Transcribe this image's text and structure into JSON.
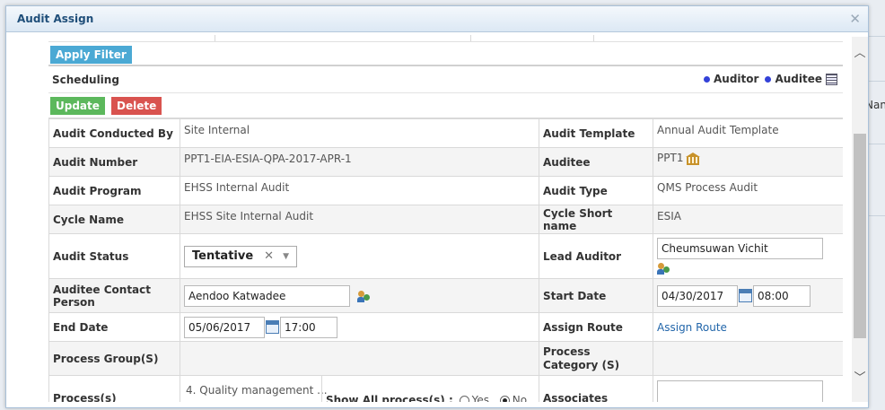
{
  "dialog": {
    "title": "Audit Assign"
  },
  "background": {
    "right_edge_text": "Nan"
  },
  "toolbar": {
    "apply_filter_label": "Apply Filter"
  },
  "scheduling": {
    "title": "Scheduling",
    "legend": [
      {
        "label": "Auditor",
        "color": "#3342d8"
      },
      {
        "label": "Auditee",
        "color": "#3342d8"
      }
    ]
  },
  "actions": {
    "update_label": "Update",
    "delete_label": "Delete"
  },
  "form": {
    "audit_conducted_by": {
      "label": "Audit Conducted By",
      "value": "Site Internal"
    },
    "audit_template": {
      "label": "Audit Template",
      "value": "Annual Audit Template"
    },
    "audit_number": {
      "label": "Audit Number",
      "value": "PPT1-EIA-ESIA-QPA-2017-APR-1"
    },
    "auditee": {
      "label": "Auditee",
      "value": "PPT1"
    },
    "audit_program": {
      "label": "Audit Program",
      "value": "EHSS Internal Audit"
    },
    "audit_type": {
      "label": "Audit Type",
      "value": "QMS Process Audit"
    },
    "cycle_name": {
      "label": "Cycle Name",
      "value": "EHSS Site Internal Audit"
    },
    "cycle_short_name": {
      "label": "Cycle Short name",
      "value": "ESIA"
    },
    "audit_status": {
      "label": "Audit Status",
      "value": "Tentative"
    },
    "lead_auditor": {
      "label": "Lead Auditor",
      "value": "Cheumsuwan Vichit"
    },
    "auditee_contact": {
      "label": "Auditee Contact Person",
      "value": "Aendoo Katwadee"
    },
    "start_date": {
      "label": "Start Date",
      "date": "04/30/2017",
      "time": "08:00"
    },
    "end_date": {
      "label": "End Date",
      "date": "05/06/2017",
      "time": "17:00"
    },
    "assign_route": {
      "label": "Assign Route",
      "link": "Assign Route"
    },
    "process_group": {
      "label": "Process Group(S)",
      "value": ""
    },
    "process_category": {
      "label": "Process Category (S)",
      "value": ""
    },
    "processes": {
      "label": "Process(s)",
      "value": "4. Quality management ...",
      "show_all_label": "Show All process(s) :",
      "options": [
        {
          "label": "Yes",
          "selected": false
        },
        {
          "label": "No",
          "selected": true
        }
      ]
    },
    "associates": {
      "label": "Associates",
      "value": ""
    }
  }
}
